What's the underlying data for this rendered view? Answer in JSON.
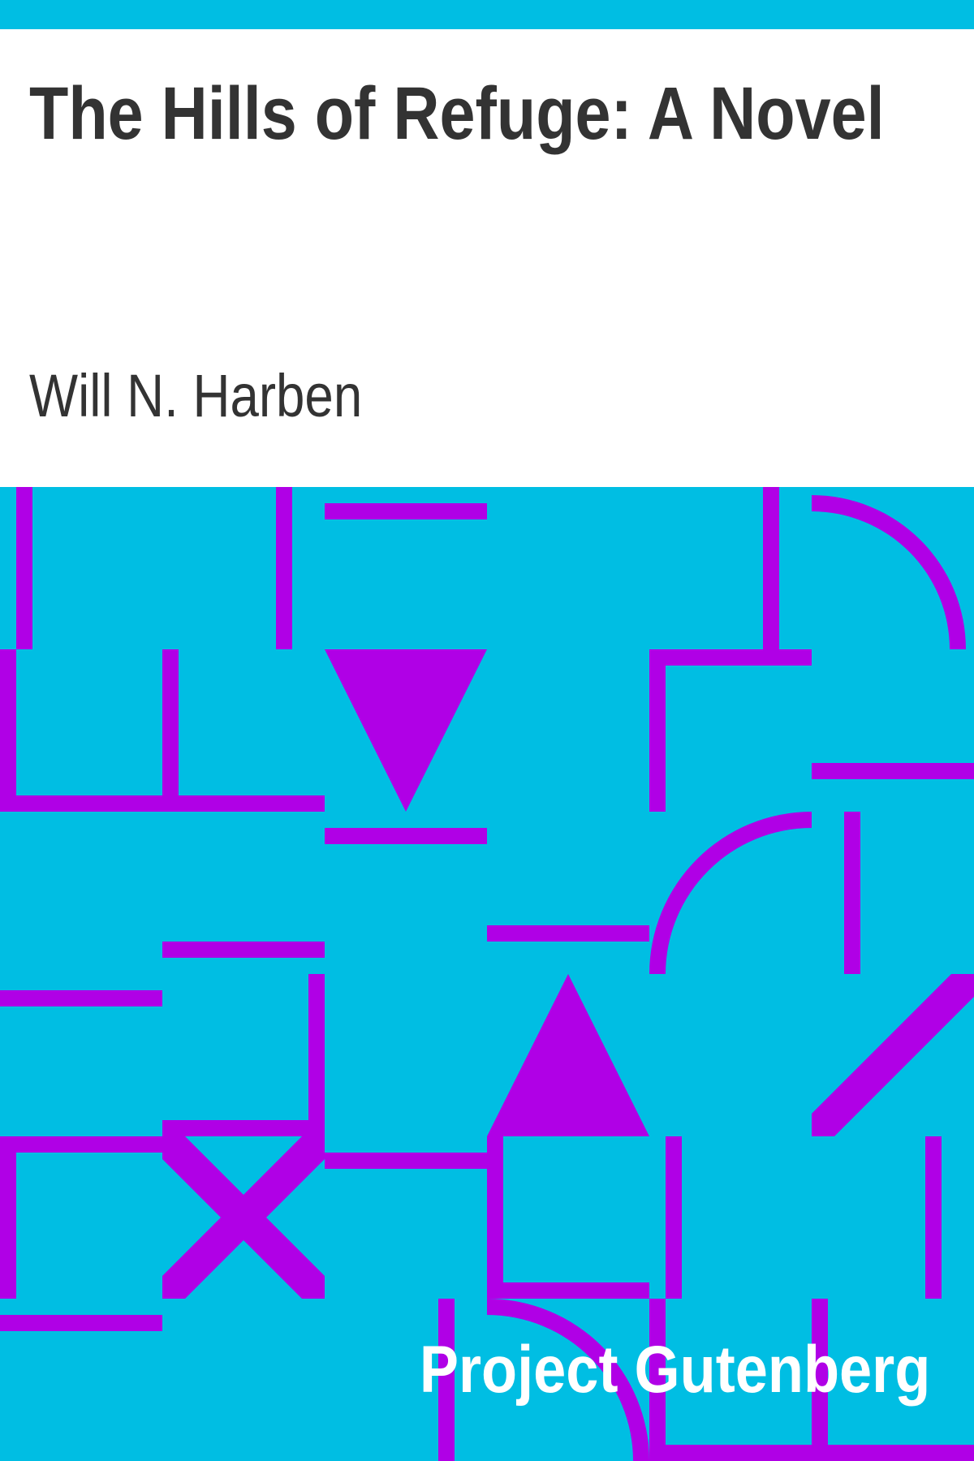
{
  "book": {
    "title": "The Hills of Refuge: A Novel",
    "author": "Will N. Harben",
    "publisher": "Project Gutenberg"
  },
  "colors": {
    "band": "#00bee3",
    "pattern_background": "#00bee3",
    "pattern_lines": "#b000e6",
    "text_dark": "#333333",
    "text_light": "#ffffff"
  }
}
